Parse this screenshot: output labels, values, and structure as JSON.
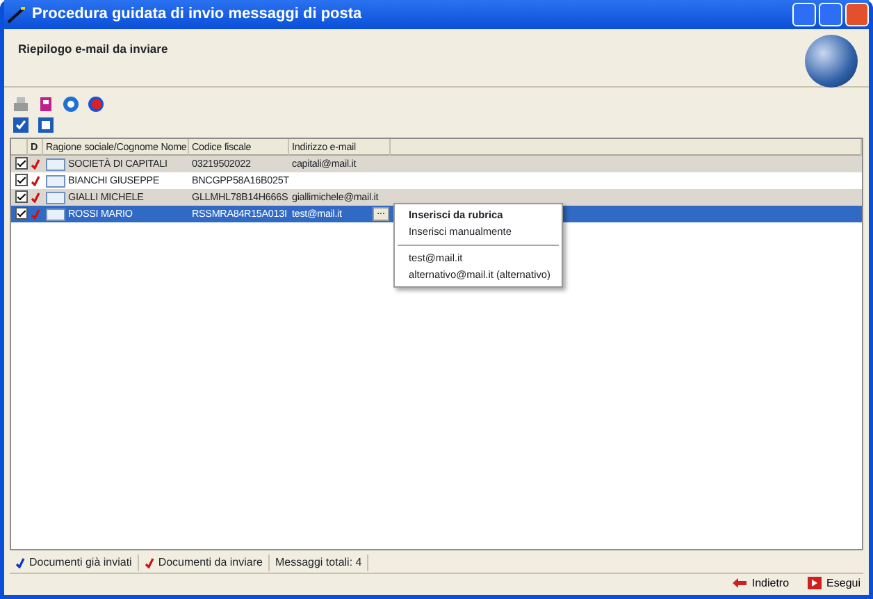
{
  "window": {
    "title": "Procedura guidata di invio messaggi di posta"
  },
  "header": {
    "title": "Riepilogo e-mail da inviare"
  },
  "table": {
    "columns": [
      "D",
      "Ragione sociale/Cognome Nome",
      "Codice fiscale",
      "Indirizzo e-mail"
    ],
    "rows": [
      {
        "checked": true,
        "selected": false,
        "name": "SOCIETÀ DI CAPITALI",
        "code": "03219502022",
        "email": "capitali@mail.it"
      },
      {
        "checked": true,
        "selected": false,
        "name": "BIANCHI GIUSEPPE",
        "code": "BNCGPP58A16B025T",
        "email": ""
      },
      {
        "checked": true,
        "selected": false,
        "name": "GIALLI MICHELE",
        "code": "GLLMHL78B14H666S",
        "email": "giallimichele@mail.it"
      },
      {
        "checked": true,
        "selected": true,
        "name": "ROSSI MARIO",
        "code": "RSSMRA84R15A013I",
        "email": "test@mail.it",
        "ellipsis": "..."
      }
    ]
  },
  "context_menu": [
    {
      "kind": "item",
      "label": "Inserisci da rubrica",
      "bold": true
    },
    {
      "kind": "item",
      "label": "Inserisci manualmente",
      "bold": false
    },
    {
      "kind": "separator"
    },
    {
      "kind": "item",
      "label": "test@mail.it",
      "bold": false
    },
    {
      "kind": "item",
      "label": "alternativo@mail.it (alternativo)",
      "bold": false
    }
  ],
  "legend": [
    {
      "label": "Documenti già inviati",
      "color": "#1030c0"
    },
    {
      "label": "Documenti da inviare",
      "color": "#d01010"
    },
    {
      "label": "Messaggi totali: 4"
    }
  ],
  "buttons": [
    "Indietro",
    "Esegui"
  ]
}
